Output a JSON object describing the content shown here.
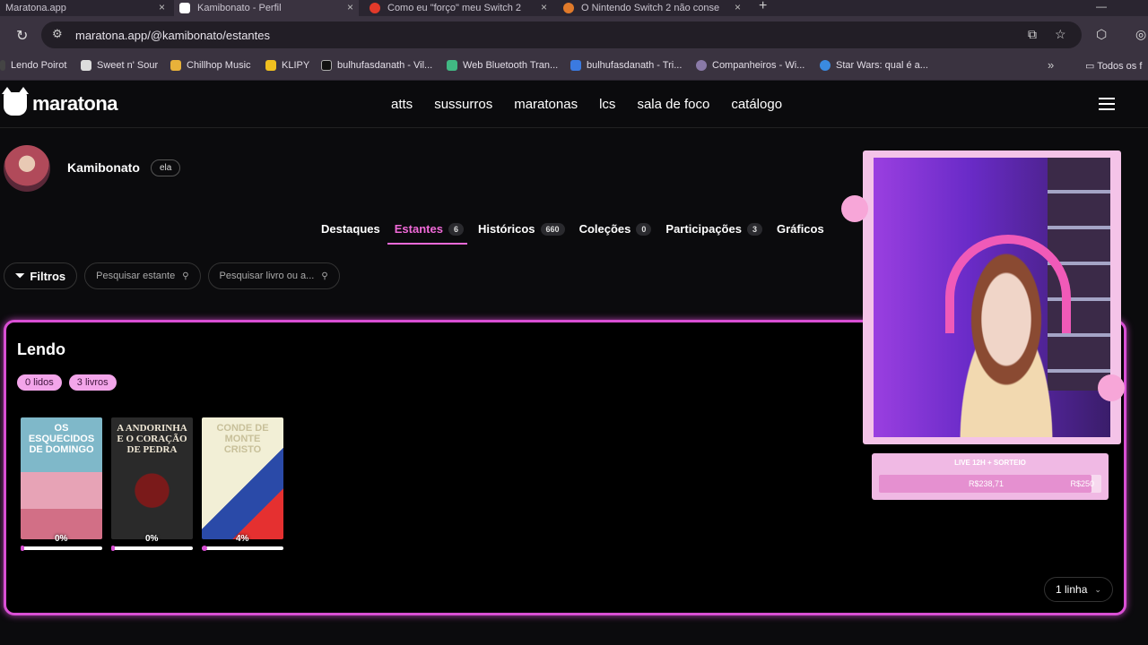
{
  "browser": {
    "tabs": [
      {
        "title": "Maratona.app",
        "active": false
      },
      {
        "title": "Kamibonato - Perfil",
        "active": true
      },
      {
        "title": "Como eu \"forço\" meu Switch 2",
        "active": false
      },
      {
        "title": "O Nintendo Switch 2 não conse",
        "active": false
      }
    ],
    "url": "maratona.app/@kamibonato/estantes",
    "bookmarks": [
      {
        "label": "Lendo Poirot",
        "color": "#444"
      },
      {
        "label": "Sweet n' Sour",
        "color": "#222"
      },
      {
        "label": "Chillhop Music",
        "color": "#e8b23a"
      },
      {
        "label": "KLIPY",
        "color": "#f0c020"
      },
      {
        "label": "bulhufasdanath - Vil...",
        "color": "#111"
      },
      {
        "label": "Web Bluetooth Tran...",
        "color": "#41b883"
      },
      {
        "label": "bulhufasdanath - Tri...",
        "color": "#3b7ae0"
      },
      {
        "label": "Companheiros - Wi...",
        "color": "#8a7aa8"
      },
      {
        "label": "Star Wars: qual é a...",
        "color": "#3a8ae0"
      }
    ],
    "all_bookmarks": "Todos os f"
  },
  "site": {
    "logo": "maratona",
    "nav": [
      "atts",
      "sussurros",
      "maratonas",
      "lcs",
      "sala de foco",
      "catálogo"
    ],
    "profile": {
      "name": "Kamibonato",
      "pronoun": "ela"
    },
    "subtabs": [
      {
        "label": "Destaques",
        "count": ""
      },
      {
        "label": "Estantes",
        "count": "6"
      },
      {
        "label": "Históricos",
        "count": "660"
      },
      {
        "label": "Coleções",
        "count": "0"
      },
      {
        "label": "Participações",
        "count": "3"
      },
      {
        "label": "Gráficos",
        "count": ""
      }
    ],
    "filters": {
      "button": "Filtros",
      "search_shelf": "Pesquisar estante",
      "search_book": "Pesquisar livro ou a..."
    },
    "shelf": {
      "title": "Lendo",
      "read_pill": "0 lidos",
      "books_pill": "3 livros",
      "books": [
        {
          "title": "OS ESQUECIDOS DE DOMINGO",
          "progress_label": "0%",
          "progress": 0
        },
        {
          "title": "A ANDORINHA E O CORAÇÃO DE PEDRA",
          "progress_label": "0%",
          "progress": 0
        },
        {
          "title": "CONDE DE MONTE CRISTO",
          "progress_label": "4%",
          "progress": 4
        }
      ],
      "rows_select": "1 linha"
    }
  },
  "overlay": {
    "goal_title": "LIVE 12H + SORTEIO",
    "goal_current": "R$238,71",
    "goal_target": "R$250",
    "goal_fraction": 0.955
  }
}
